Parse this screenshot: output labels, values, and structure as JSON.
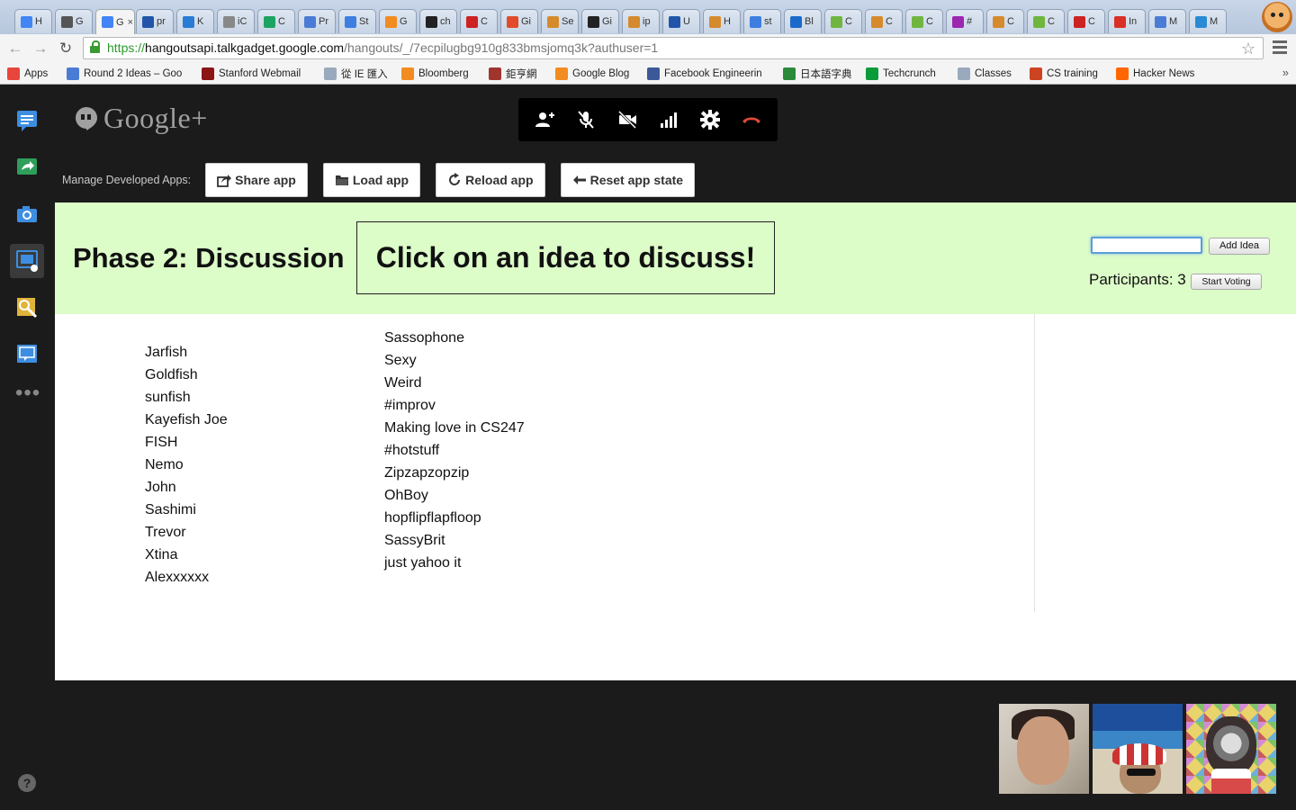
{
  "browser": {
    "tabs": [
      {
        "label": "H",
        "color": "#4285f4"
      },
      {
        "label": "G",
        "color": "#555555"
      },
      {
        "label": "G",
        "color": "#4285f4",
        "active": true
      },
      {
        "label": "pr",
        "color": "#2255aa"
      },
      {
        "label": "K",
        "color": "#2a7bd5"
      },
      {
        "label": "iC",
        "color": "#888888"
      },
      {
        "label": "C",
        "color": "#1da462"
      },
      {
        "label": "Pr",
        "color": "#4a7cd6"
      },
      {
        "label": "St",
        "color": "#3d7ee0"
      },
      {
        "label": "G",
        "color": "#f28b20"
      },
      {
        "label": "ch",
        "color": "#222222"
      },
      {
        "label": "C",
        "color": "#cc2222"
      },
      {
        "label": "Gi",
        "color": "#e24b2a"
      },
      {
        "label": "Se",
        "color": "#d68a2e"
      },
      {
        "label": "Gi",
        "color": "#222222"
      },
      {
        "label": "ip",
        "color": "#d68a2e"
      },
      {
        "label": "U",
        "color": "#2255aa"
      },
      {
        "label": "H",
        "color": "#d68a2e"
      },
      {
        "label": "st",
        "color": "#3d7ee0"
      },
      {
        "label": "Bl",
        "color": "#1b6ac9"
      },
      {
        "label": "C",
        "color": "#6fb53f"
      },
      {
        "label": "C",
        "color": "#d68a2e"
      },
      {
        "label": "C",
        "color": "#6fb53f"
      },
      {
        "label": "#",
        "color": "#9c27b0"
      },
      {
        "label": "C",
        "color": "#d68a2e"
      },
      {
        "label": "C",
        "color": "#6fb53f"
      },
      {
        "label": "C",
        "color": "#cc2222"
      },
      {
        "label": "In",
        "color": "#d93025"
      },
      {
        "label": "M",
        "color": "#4a7cd6"
      },
      {
        "label": "M",
        "color": "#2a8bd5"
      }
    ],
    "url": {
      "scheme": "https://",
      "host": "hangoutsapi.talkgadget.google.com",
      "rest": "/hangouts/_/7ecpilugbg910g833bmsjomq3k?authuser=1"
    },
    "bookmarks": [
      {
        "label": "Apps",
        "color": "#e8453c"
      },
      {
        "label": "Round 2 Ideas – Goo",
        "color": "#4a7cd6"
      },
      {
        "label": "Stanford Webmail",
        "color": "#8c1515"
      },
      {
        "label": "從 IE 匯入",
        "color": "#9aa9bd"
      },
      {
        "label": "Bloomberg",
        "color": "#f28b20"
      },
      {
        "label": "鉅亨網",
        "color": "#a0352f"
      },
      {
        "label": "Google Blog",
        "color": "#f28b20"
      },
      {
        "label": "Facebook Engineerin",
        "color": "#3b5998"
      },
      {
        "label": "日本語字典",
        "color": "#2a8a3a"
      },
      {
        "label": "Techcrunch",
        "color": "#0a9b3a"
      },
      {
        "label": "Classes",
        "color": "#9aa9bd"
      },
      {
        "label": "CS training",
        "color": "#cc4422"
      },
      {
        "label": "Hacker News",
        "color": "#ff6600"
      }
    ],
    "more": "»"
  },
  "hangout": {
    "brand": "Google+",
    "dev_label": "Manage Developed Apps:",
    "dev_buttons": [
      "Share app",
      "Load app",
      "Reload app",
      "Reset app state"
    ],
    "rail_icons": [
      "chat-icon",
      "screenshare-icon",
      "camera-icon",
      "app-icon",
      "effects-icon",
      "app-icon-2"
    ],
    "help": "?"
  },
  "app": {
    "phase": "Phase 2: Discussion",
    "prompt": "Click on an idea to discuss!",
    "idea_input_value": "",
    "add_button": "Add Idea",
    "participants_label": "Participants: 3",
    "vote_button": "Start Voting",
    "ideas_left": [
      "Jarfish",
      "Goldfish",
      "sunfish",
      "Kayefish Joe",
      "FISH",
      "Nemo",
      "John",
      "Sashimi",
      "Trevor",
      "Xtina",
      "Alexxxxxx"
    ],
    "ideas_right": [
      "Sassophone",
      "Sexy",
      "Weird",
      "#improv",
      "Making love in CS247",
      "#hotstuff",
      "Zipzapzopzip",
      "OhBoy",
      "hopflipflapfloop",
      "SassyBrit",
      "just yahoo it"
    ]
  },
  "colors": {
    "app_header_bg": "#dcfcc8",
    "hangout_bg": "#1b1b1b",
    "hangup_red": "#e04a3a",
    "rail_blue": "#3d8ee0"
  }
}
